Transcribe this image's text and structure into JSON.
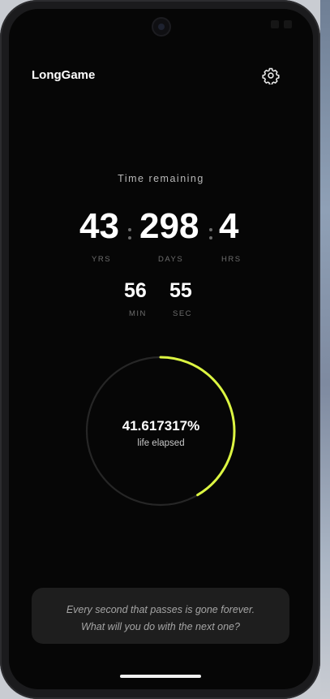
{
  "app": {
    "title": "LongGame",
    "settings_icon": "gear-icon"
  },
  "countdown": {
    "label": "Time remaining",
    "years": "43",
    "years_unit": "YRS",
    "days": "298",
    "days_unit": "DAYS",
    "hours": "4",
    "hours_unit": "HRS",
    "minutes": "56",
    "minutes_unit": "MIN",
    "seconds": "55",
    "seconds_unit": "SEC"
  },
  "progress": {
    "percent_text": "41.617317%",
    "label": "life elapsed",
    "fraction": 0.41617317,
    "accent_color": "#dcf542",
    "track_color": "#262626"
  },
  "quote": {
    "line1": "Every second that passes is gone forever.",
    "line2": "What will you do with the next one?"
  }
}
